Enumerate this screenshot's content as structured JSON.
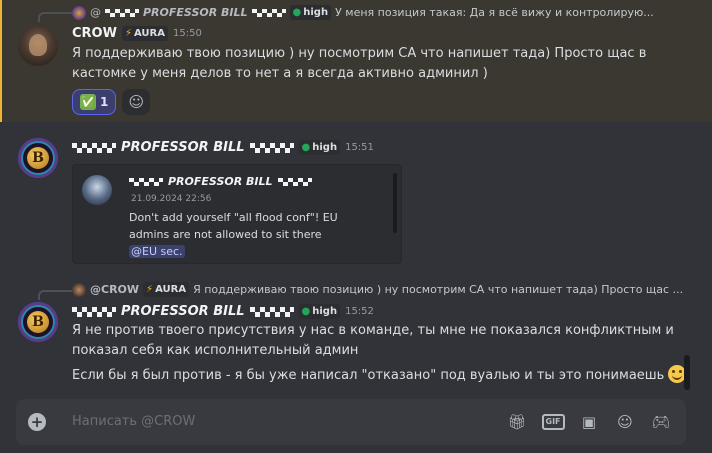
{
  "messages": [
    {
      "id": "crow",
      "reply": {
        "mention": "@",
        "name": "PROFESSOR BILL",
        "tag": "high",
        "text": "У меня позиция такая: Да я всё вижу и контролирую..."
      },
      "author": "CROW",
      "tag": "AURA",
      "time": "15:50",
      "lines": [
        "Я поддерживаю твою позицию ) ну посмотрим СА что напишет тада) Просто щас в",
        "кастомке у меня делов то нет а я всегда активно админил )"
      ],
      "reaction": {
        "emoji": "✅",
        "count": "1"
      }
    },
    {
      "id": "bill1",
      "author": "PROFESSOR BILL",
      "tag": "high",
      "time": "15:51",
      "embed": {
        "author": "PROFESSOR BILL",
        "date": "21.09.2024 22:56",
        "text": "Don't add yourself \"all flood conf\"! EU admins are not allowed to sit there",
        "mention": "@EU sec."
      }
    },
    {
      "id": "bill2",
      "reply": {
        "mention": "@CROW",
        "tag": "AURA",
        "text": "Я поддерживаю твою позицию ) ну посмотрим СА что напишет тада) Просто щас ..."
      },
      "author": "PROFESSOR BILL",
      "tag": "high",
      "time": "15:52",
      "lines": [
        "Я не против твоего присутствия у нас в команде, ты мне не показался конфликтным и",
        "показал себя как исполнительный админ"
      ],
      "line3": "Если бы я был против - я бы уже написал \"отказано\" под вуалью и ты это понимаешь"
    }
  ],
  "composer": {
    "placeholder": "Написать @CROW",
    "gif_label": "GIF"
  },
  "icons": {
    "add": "plus-circle-icon",
    "gift": "gift-icon",
    "gif": "gif-icon",
    "sticker": "sticker-icon",
    "emoji": "emoji-icon",
    "activities": "gamepad-icon"
  }
}
